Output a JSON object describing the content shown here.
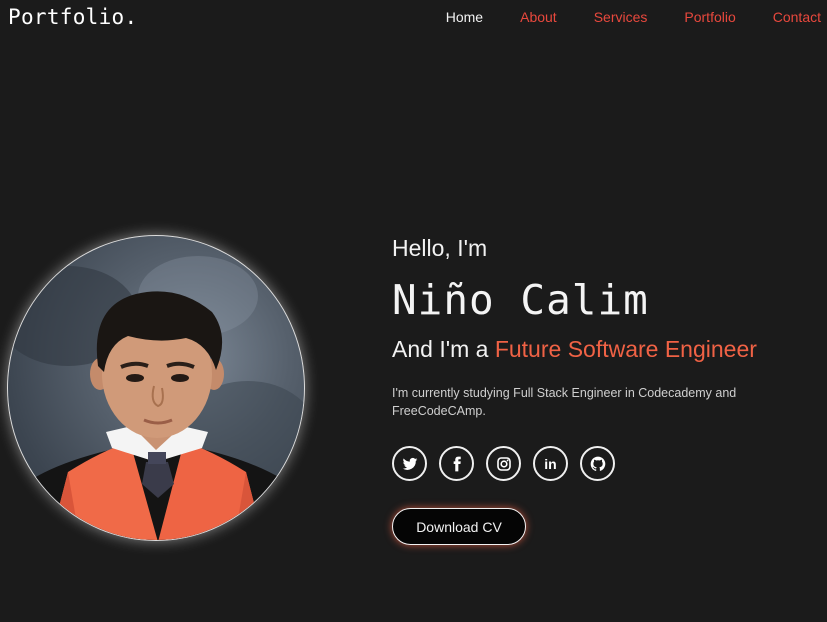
{
  "header": {
    "logo": "Portfolio.",
    "nav": [
      {
        "label": "Home",
        "active": true
      },
      {
        "label": "About",
        "active": false
      },
      {
        "label": "Services",
        "active": false
      },
      {
        "label": "Portfolio",
        "active": false
      },
      {
        "label": "Contact",
        "active": false
      }
    ]
  },
  "hero": {
    "greeting": "Hello, I'm",
    "name": "Niño Calim",
    "role_prefix": "And I'm a ",
    "role_highlight": "Future Software Engineer",
    "description": "I'm currently studying Full Stack Engineer in Codecademy and FreeCodeCAmp.",
    "download_label": "Download CV"
  },
  "socials": [
    {
      "icon": "twitter-icon"
    },
    {
      "icon": "facebook-icon"
    },
    {
      "icon": "instagram-icon"
    },
    {
      "icon": "linkedin-icon",
      "text": "in"
    },
    {
      "icon": "github-icon"
    }
  ],
  "colors": {
    "background": "#1b1b1b",
    "accent": "#f06245",
    "nav_link": "#e8483d",
    "text": "#f2f2f2"
  }
}
